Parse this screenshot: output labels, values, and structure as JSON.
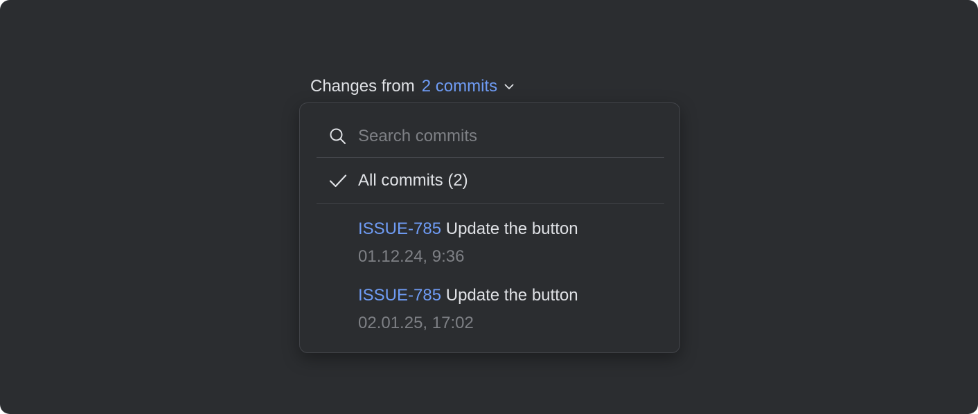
{
  "header": {
    "label": "Changes from",
    "commits_label": "2 commits"
  },
  "popup": {
    "search_placeholder": "Search commits",
    "search_value": "",
    "all_commits_label": "All commits (2)",
    "commits": [
      {
        "id": "ISSUE-785",
        "message": "Update the button",
        "date": "01.12.24, 9:36"
      },
      {
        "id": "ISSUE-785",
        "message": "Update the button",
        "date": "02.01.25, 17:02"
      }
    ]
  },
  "icons": {
    "chevron": "chevron-down-icon",
    "search": "search-icon",
    "check": "check-icon"
  },
  "colors": {
    "background": "#2b2d30",
    "accent": "#6f9cf5",
    "text": "#dfe1e5",
    "muted": "#7e8085",
    "border": "#43454a"
  }
}
